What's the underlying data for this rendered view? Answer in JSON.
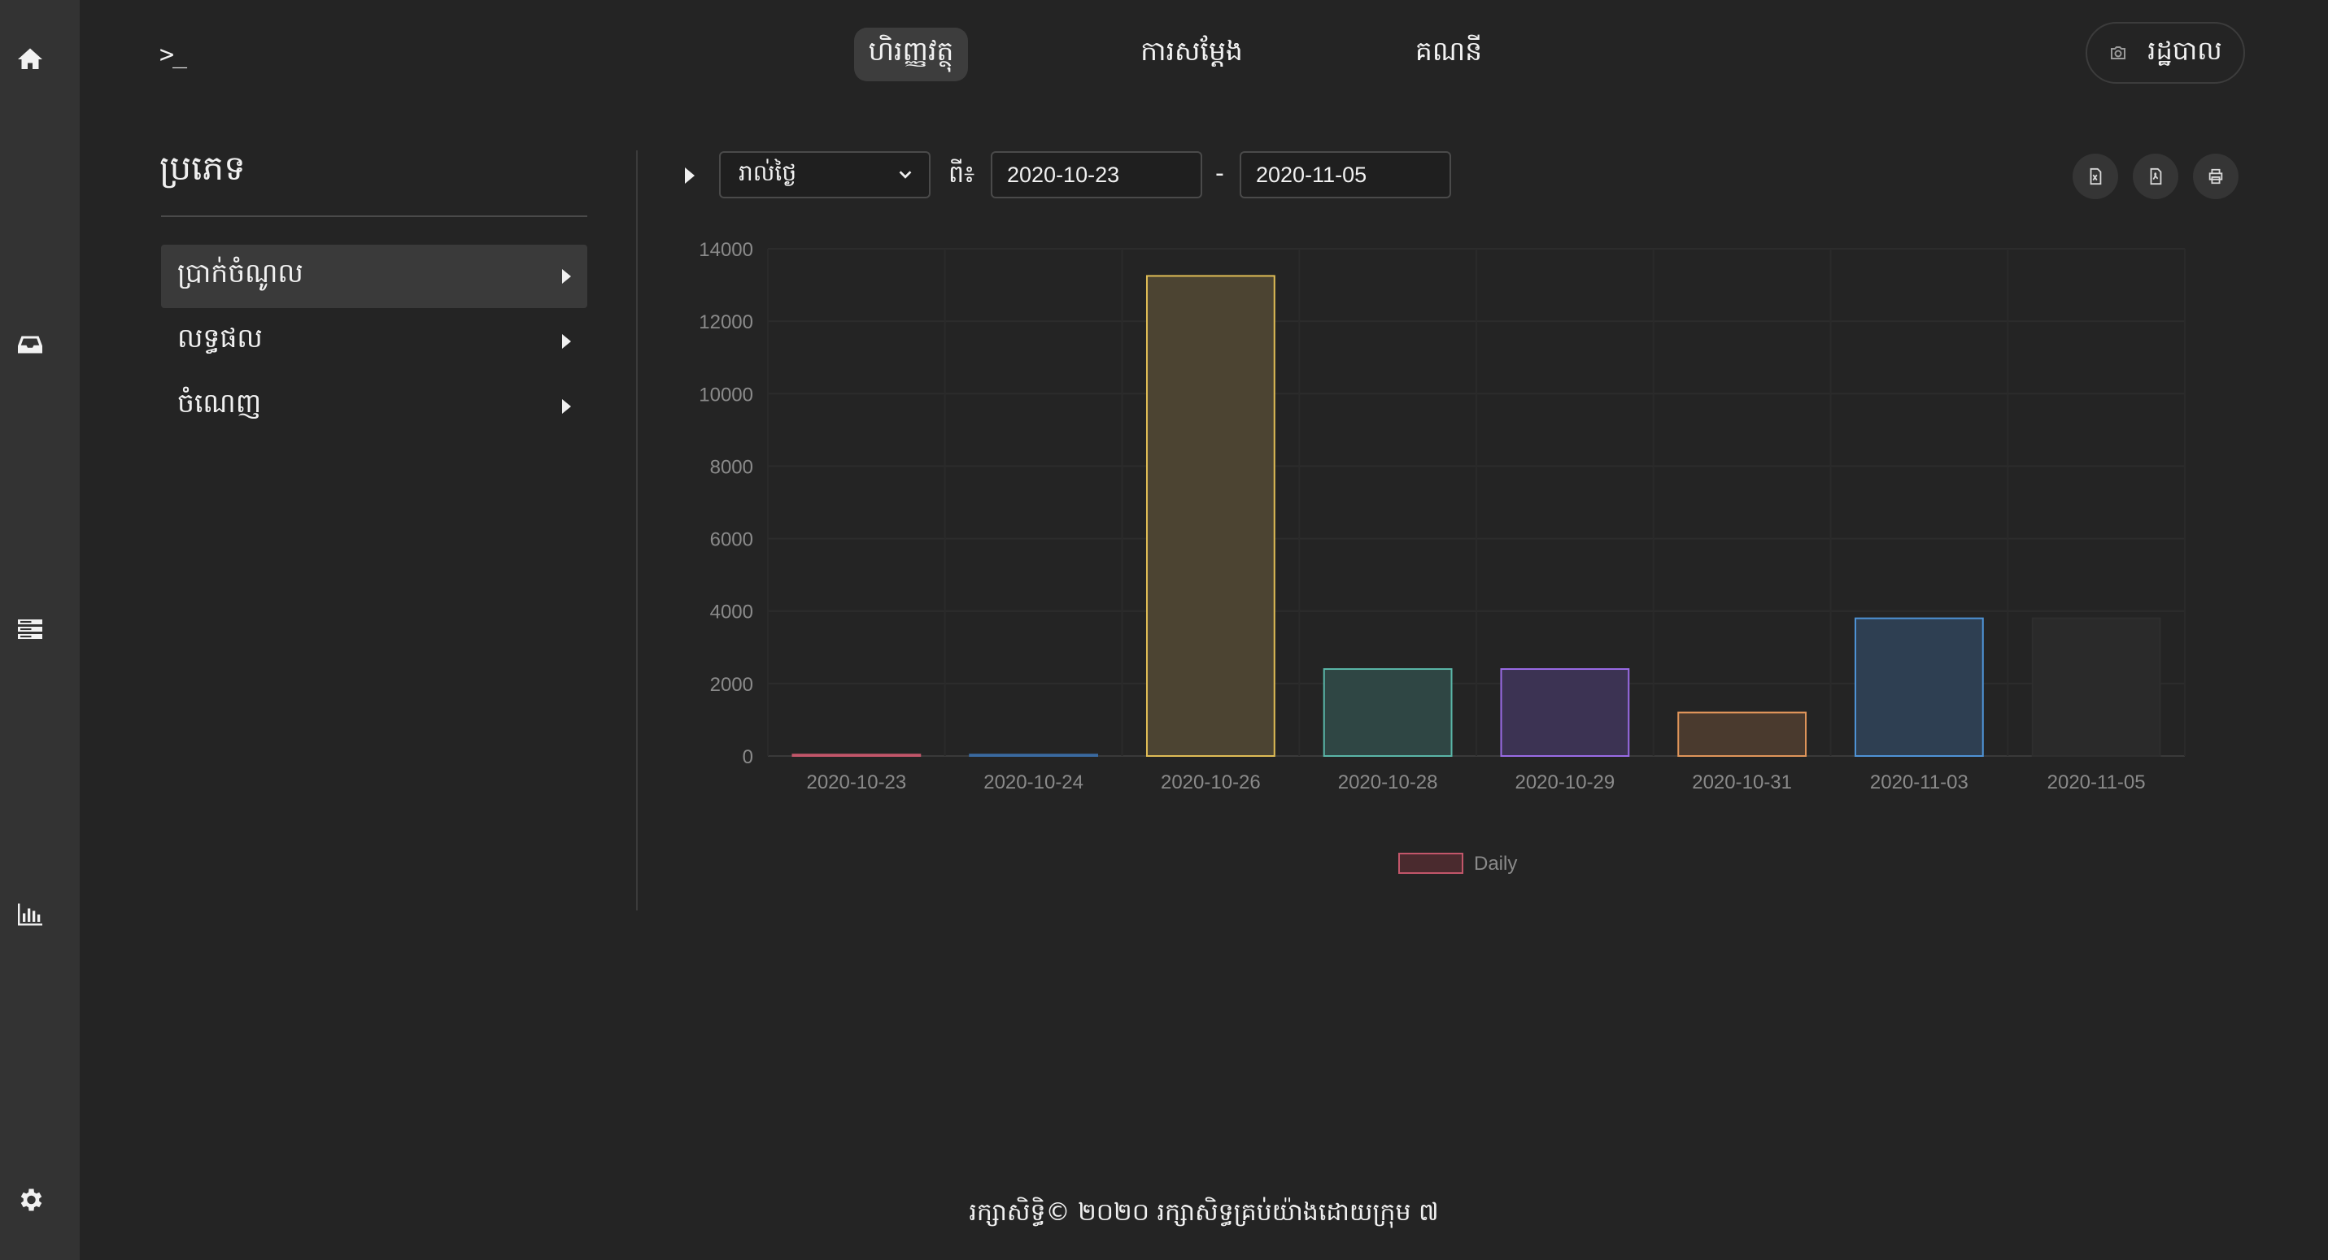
{
  "rail": {
    "icons": [
      "home-icon",
      "inbox-icon",
      "storage-icon",
      "bar-chart-icon",
      "gear-icon"
    ]
  },
  "topbar": {
    "prompt": ">_",
    "tabs": [
      {
        "label": "ហិរញ្ញវត្ថុ",
        "active": true
      },
      {
        "label": "ការសម្តែង",
        "active": false
      },
      {
        "label": "គណនី",
        "active": false
      }
    ],
    "admin_label": "រដ្ឋបាល"
  },
  "sidebar": {
    "title": "ប្រភេទ",
    "items": [
      {
        "label": "ប្រាក់ចំណូល",
        "active": true
      },
      {
        "label": "លទ្ធផល",
        "active": false
      },
      {
        "label": "ចំណេញ",
        "active": false
      }
    ]
  },
  "filters": {
    "period_value": "រាល់ថ្ងៃ",
    "from_label": "ពី៖",
    "start_date": "2020-10-23",
    "separator": "-",
    "end_date": "2020-11-05"
  },
  "toolbar": {
    "icons": [
      "excel-export-icon",
      "pdf-export-icon",
      "print-icon"
    ]
  },
  "chart_data": {
    "type": "bar",
    "categories": [
      "2020-10-23",
      "2020-10-24",
      "2020-10-26",
      "2020-10-28",
      "2020-10-29",
      "2020-10-31",
      "2020-11-03",
      "2020-11-05"
    ],
    "series": [
      {
        "name": "Daily",
        "values": [
          40,
          40,
          13250,
          2400,
          2400,
          1200,
          3800,
          3800
        ]
      }
    ],
    "ylim": [
      0,
      14000
    ],
    "yticks": [
      0,
      2000,
      4000,
      6000,
      8000,
      10000,
      12000,
      14000
    ],
    "grid": true,
    "legend": "bottom",
    "bar_colors": [
      {
        "fill": "#4a2a2e",
        "stroke": "#c2566a"
      },
      {
        "fill": "#2a3848",
        "stroke": "#3a6aa0"
      },
      {
        "fill": "#4c4432",
        "stroke": "#e0bd56"
      },
      {
        "fill": "#2f4644",
        "stroke": "#5ab6a8"
      },
      {
        "fill": "#3c3353",
        "stroke": "#9a6be6"
      },
      {
        "fill": "#4a3a2e",
        "stroke": "#e0955a"
      },
      {
        "fill": "#2e3f52",
        "stroke": "#4f93d6"
      },
      {
        "fill": "#2a2a2a",
        "stroke": "#2e2e2e"
      }
    ],
    "legend_color": {
      "fill": "#4a2a2e",
      "stroke": "#c2566a"
    }
  },
  "footer": {
    "text": "រក្សាសិទ្ធិ© ២០២០ រក្សាសិទ្ធគ្រប់យ៉ាងដោយក្រុម ៧"
  }
}
